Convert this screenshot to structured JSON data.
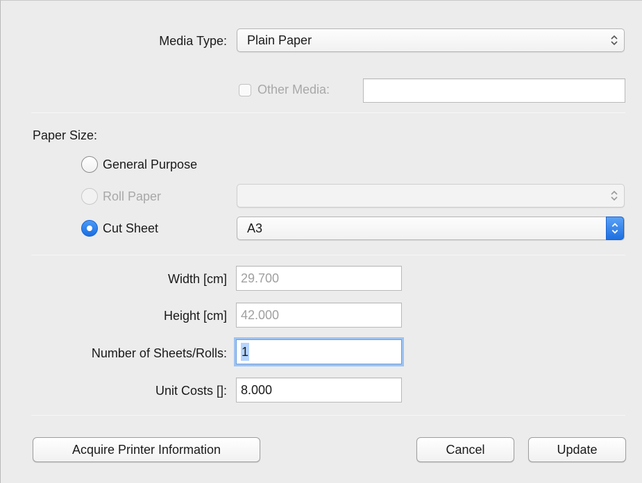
{
  "media": {
    "label": "Media Type:",
    "selected": "Plain Paper",
    "other_media_label": "Other Media:",
    "other_media_value": ""
  },
  "paper_size": {
    "label": "Paper Size:",
    "options": [
      {
        "label": "General Purpose",
        "selected": false,
        "enabled": true
      },
      {
        "label": "Roll Paper",
        "selected": false,
        "enabled": false
      },
      {
        "label": "Cut Sheet",
        "selected": true,
        "enabled": true
      }
    ],
    "roll_paper_value": "",
    "cut_sheet_value": "A3"
  },
  "dimensions": {
    "width_label": "Width [cm]",
    "width_value": "29.700",
    "height_label": "Height [cm]",
    "height_value": "42.000",
    "sheets_label": "Number of Sheets/Rolls:",
    "sheets_value": "1",
    "unit_costs_label": "Unit Costs []:",
    "unit_costs_value": "8.000"
  },
  "buttons": {
    "acquire": "Acquire Printer Information",
    "cancel": "Cancel",
    "update": "Update"
  },
  "colors": {
    "accent": "#1a6ee3",
    "window_bg": "#ececec"
  }
}
